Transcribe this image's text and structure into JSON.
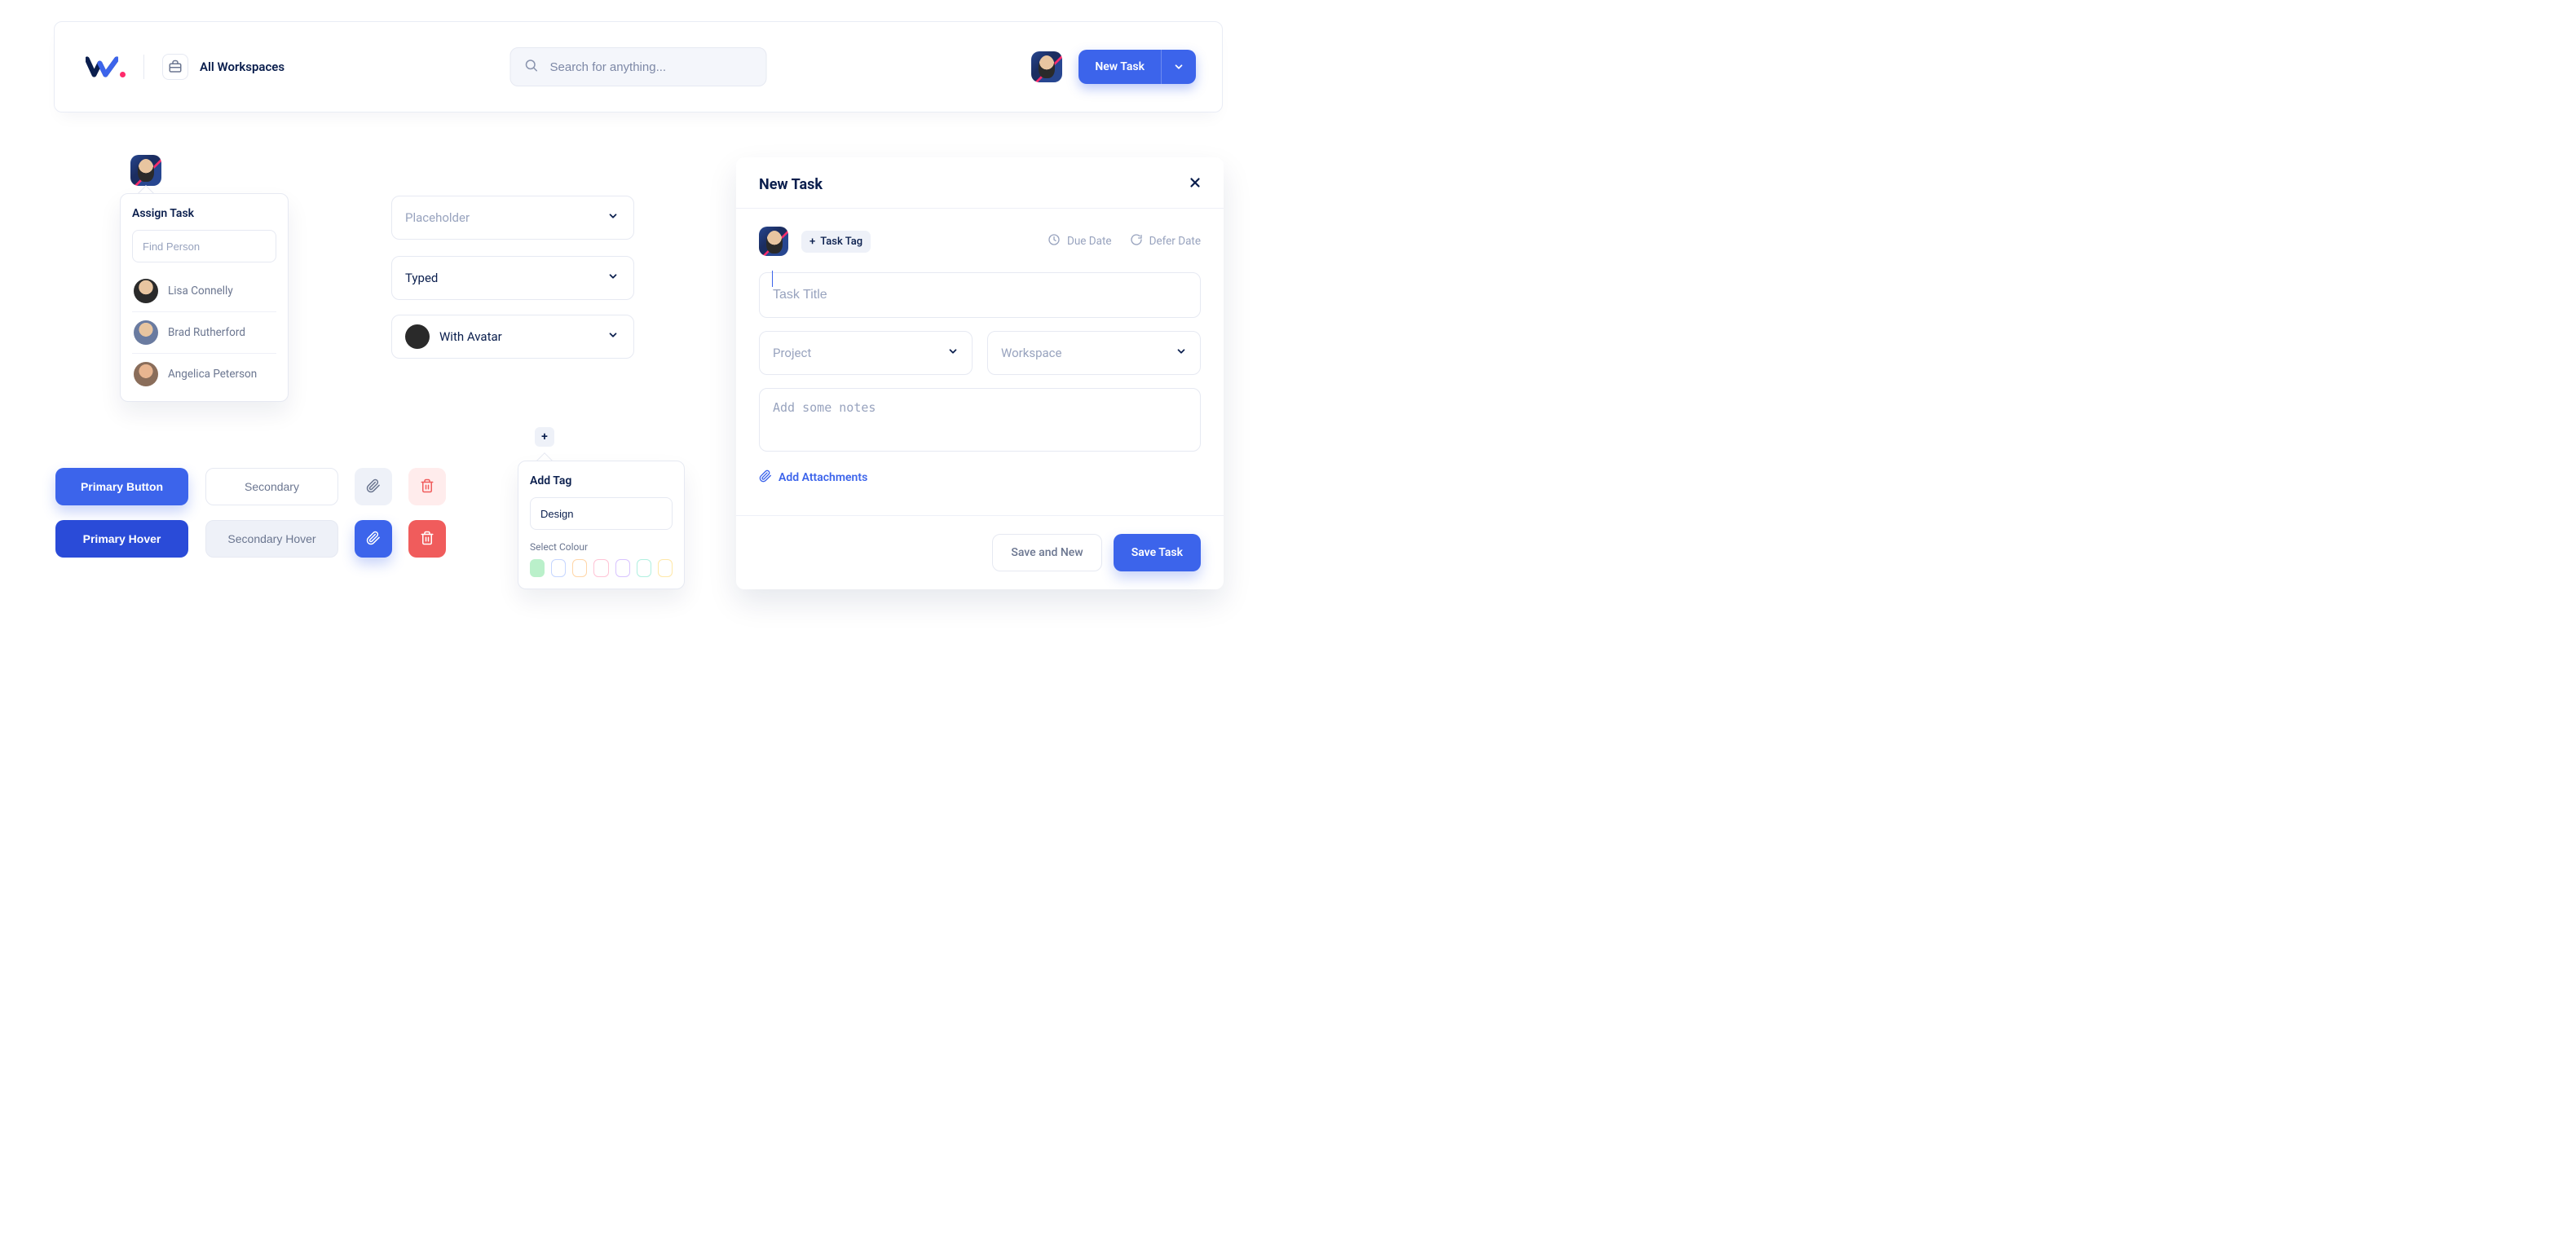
{
  "colors": {
    "primary": "#3c64eb",
    "primary_hover": "#2a4bd8",
    "danger": "#f05c5c",
    "text": "#0a1e4d",
    "muted": "#98a3be"
  },
  "header": {
    "workspaces_label": "All Workspaces",
    "search_placeholder": "Search for anything...",
    "new_task_label": "New Task"
  },
  "assign": {
    "title": "Assign Task",
    "find_placeholder": "Find Person",
    "people": [
      "Lisa Connelly",
      "Brad Rutherford",
      "Angelica Peterson"
    ]
  },
  "selects": {
    "placeholder": "Placeholder",
    "typed": "Typed",
    "with_avatar": "With Avatar"
  },
  "buttons": {
    "primary": "Primary Button",
    "primary_hover": "Primary Hover",
    "secondary": "Secondary",
    "secondary_hover": "Secondary Hover"
  },
  "tag_popover": {
    "title": "Add Tag",
    "input_value": "Design",
    "select_colour_label": "Select Colour"
  },
  "panel": {
    "title": "New Task",
    "task_tag_label": "Task Tag",
    "due_date": "Due Date",
    "defer_date": "Defer Date",
    "title_placeholder": "Task Title",
    "project_placeholder": "Project",
    "workspace_placeholder": "Workspace",
    "notes_placeholder": "Add some notes",
    "add_attachments": "Add Attachments",
    "save_and_new": "Save and New",
    "save_task": "Save Task"
  }
}
